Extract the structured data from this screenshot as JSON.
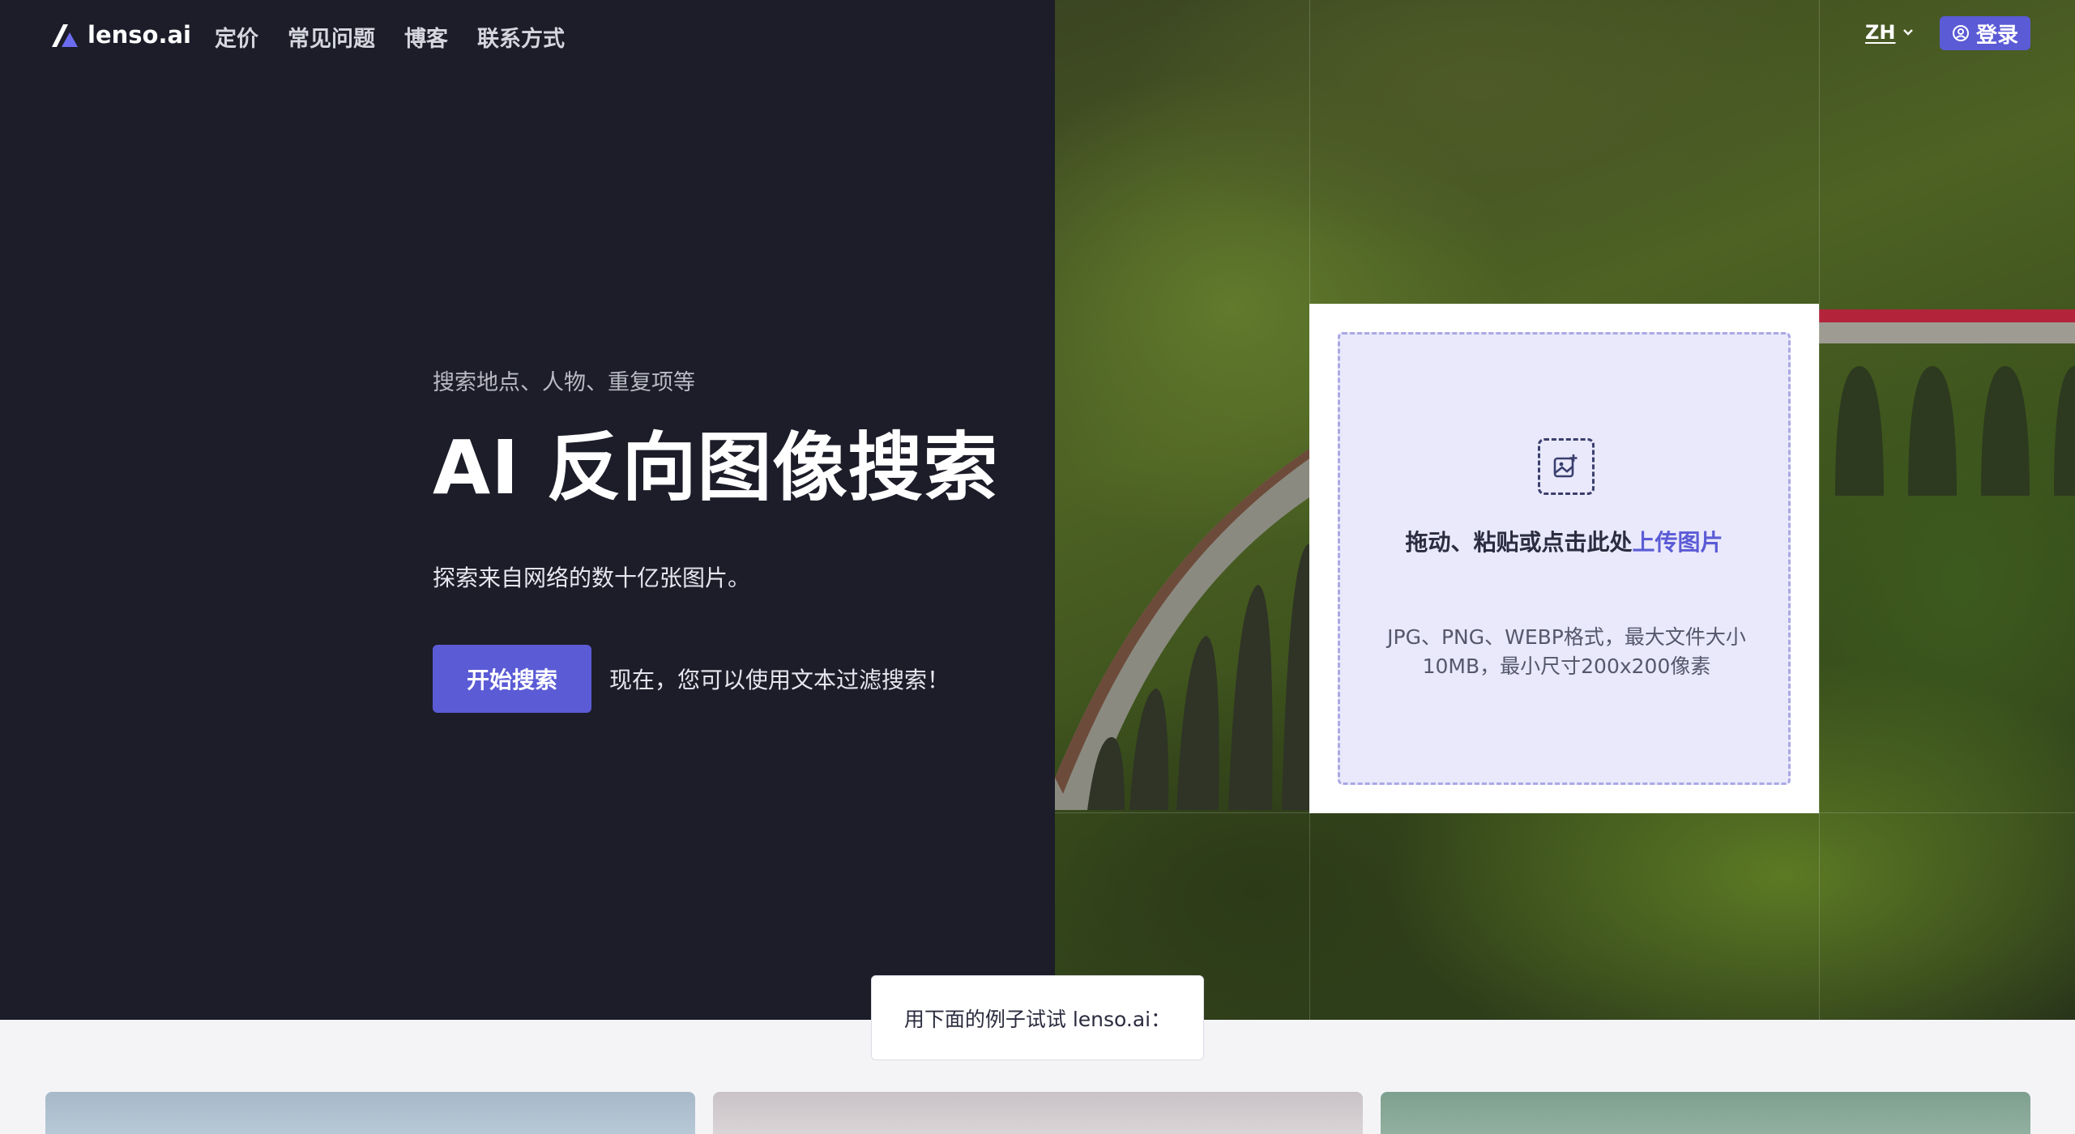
{
  "nav": {
    "brand": "lenso.ai",
    "links": [
      "定价",
      "常见问题",
      "博客",
      "联系方式"
    ],
    "language": "ZH",
    "login": "登录"
  },
  "hero": {
    "eyebrow": "搜索地点、人物、重复项等",
    "headline": "AI 反向图像搜索",
    "subtitle": "探索来自网络的数十亿张图片。",
    "cta": "开始搜索",
    "cta_note": "现在，您可以使用文本过滤搜索！"
  },
  "upload": {
    "title_prefix": "拖动、粘贴或点击此处",
    "title_link": "上传图片",
    "hint": "JPG、PNG、WEBP格式，最大文件大小10MB，最小尺寸200x200像素"
  },
  "examples": {
    "banner": "用下面的例子试试 lenso.ai："
  },
  "colors": {
    "accent": "#5b5bd6",
    "hero_bg": "#1c1d29",
    "page_bg": "#f4f4f7"
  },
  "icons": {
    "brand": "lenso-logo-icon",
    "chevron": "chevron-down-icon",
    "user": "user-circle-icon",
    "upload": "image-add-icon"
  }
}
